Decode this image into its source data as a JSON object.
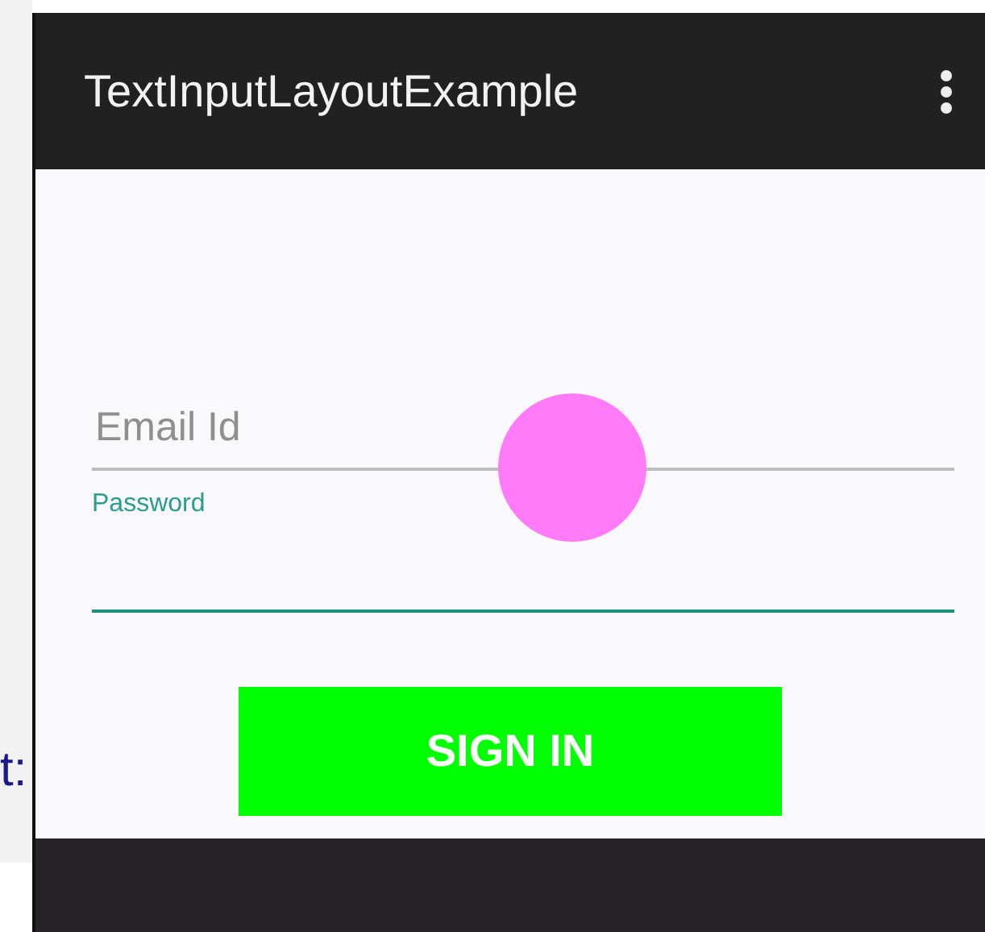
{
  "side_text": "t:",
  "app_bar": {
    "title": "TextInputLayoutExample"
  },
  "fields": [
    {
      "kind": "email",
      "placeholder": "Email Id",
      "focused": false
    },
    {
      "kind": "password",
      "label": "Password",
      "focused": true
    }
  ],
  "button": {
    "label": "SIGN IN"
  }
}
